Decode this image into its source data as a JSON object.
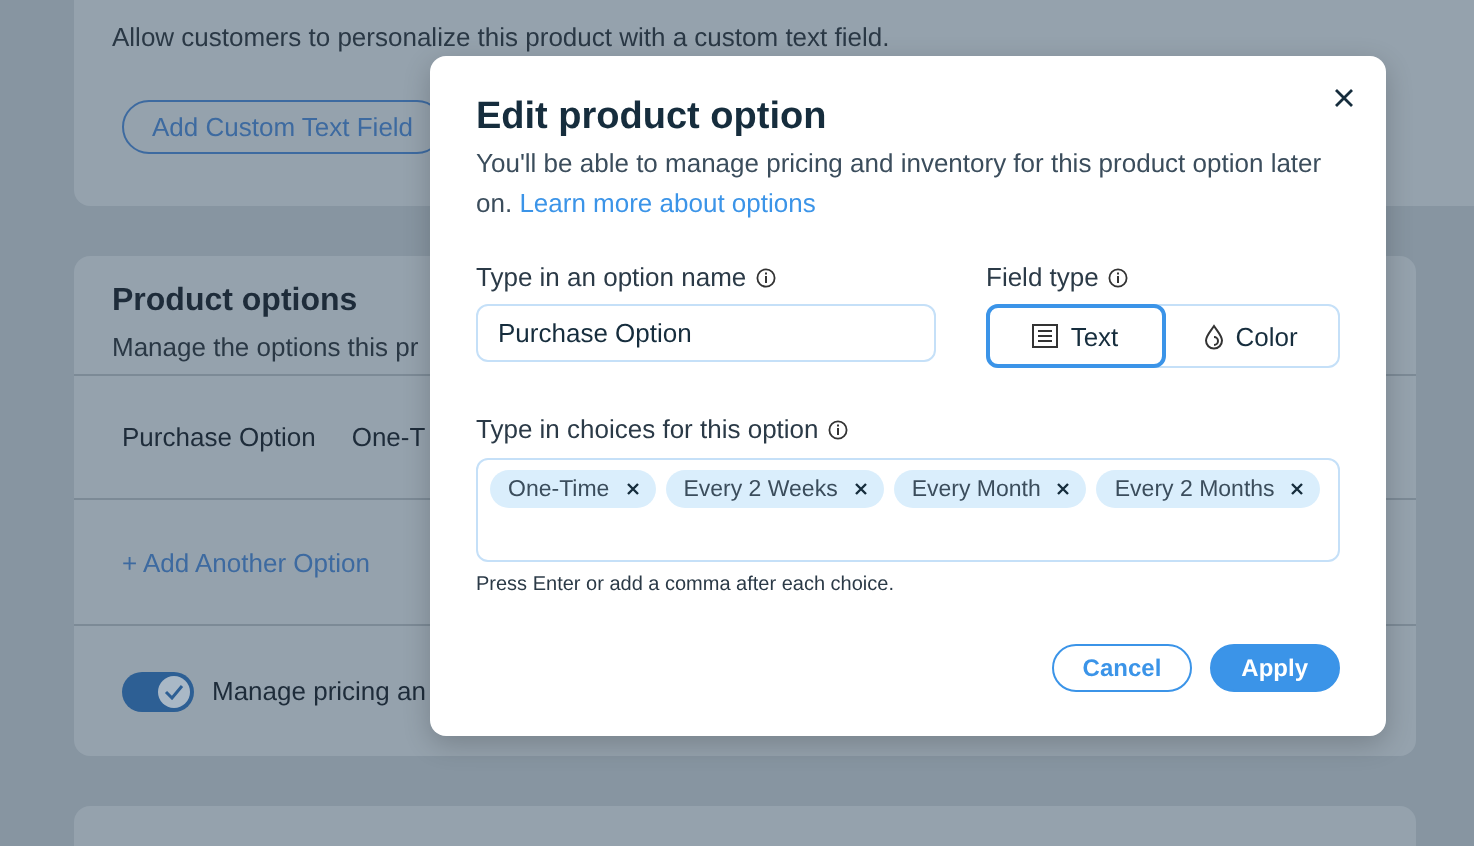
{
  "background": {
    "custom_text": {
      "description": "Allow customers to personalize this product with a custom text field.",
      "button": "Add Custom Text Field"
    },
    "product_options": {
      "title": "Product options",
      "description": "Manage the options this pr",
      "rows": [
        {
          "name": "Purchase Option",
          "choices": "One-T"
        }
      ],
      "add_link": "+ Add Another Option",
      "toggle": {
        "on": true,
        "label": "Manage pricing an"
      }
    }
  },
  "dialog": {
    "title": "Edit product option",
    "description": "You'll be able to manage pricing and inventory for this product option later on.",
    "link": "Learn more about options",
    "name_field": {
      "label": "Type in an option name",
      "value": "Purchase Option"
    },
    "field_type": {
      "label": "Field type",
      "options": [
        {
          "label": "Text",
          "kind": "text",
          "selected": true
        },
        {
          "label": "Color",
          "kind": "color",
          "selected": false
        }
      ]
    },
    "choices": {
      "label": "Type in choices for this option",
      "tags": [
        "One-Time",
        "Every 2 Weeks",
        "Every Month",
        "Every 2 Months"
      ],
      "hint": "Press Enter or add a comma after each choice."
    },
    "buttons": [
      {
        "label": "Cancel",
        "kind": "secondary"
      },
      {
        "label": "Apply",
        "kind": "primary"
      }
    ]
  }
}
